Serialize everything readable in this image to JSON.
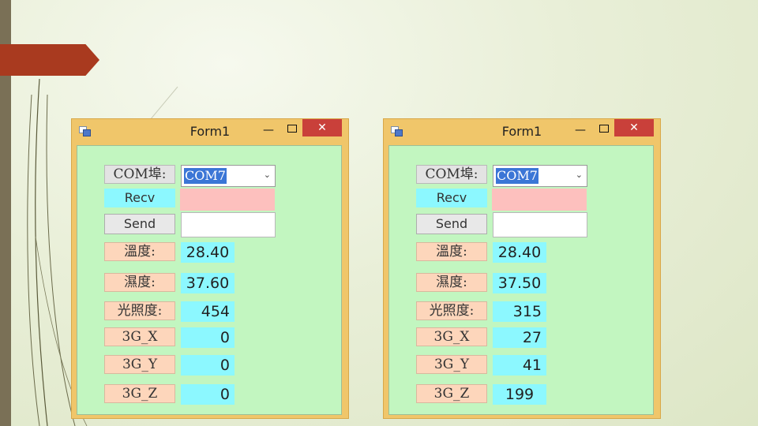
{
  "windows": [
    {
      "title": "Form1",
      "min_glyph": "—",
      "close_glyph": "✕",
      "com_label": "COM埠:",
      "com_value": "COM7",
      "recv_label": "Recv",
      "send_label": "Send",
      "temp_label": "溫度:",
      "temp_value": "28.40",
      "humidity_label": "濕度:",
      "humidity_value": "37.60",
      "light_label": "光照度:",
      "light_value": "454",
      "x_label": "3G_X",
      "x_value": "0",
      "y_label": "3G_Y",
      "y_value": "0",
      "z_label": "3G_Z",
      "z_value": "0"
    },
    {
      "title": "Form1",
      "min_glyph": "—",
      "close_glyph": "✕",
      "com_label": "COM埠:",
      "com_value": "COM7",
      "recv_label": "Recv",
      "send_label": "Send",
      "temp_label": "溫度:",
      "temp_value": "28.40",
      "humidity_label": "濕度:",
      "humidity_value": "37.50",
      "light_label": "光照度:",
      "light_value": "315",
      "x_label": "3G_X",
      "x_value": "27",
      "y_label": "3G_Y",
      "y_value": "41",
      "z_label": "3G_Z",
      "z_value": "199"
    }
  ],
  "colors": {
    "title_bar": "#f0c66a",
    "client_bg": "#c2f6c0",
    "label_bg": "#fdd6bb",
    "value_bg": "#8cf8ff",
    "recv_box": "#fdc0be",
    "close_button": "#c9403a",
    "accent_arrow": "#a93a1f"
  }
}
